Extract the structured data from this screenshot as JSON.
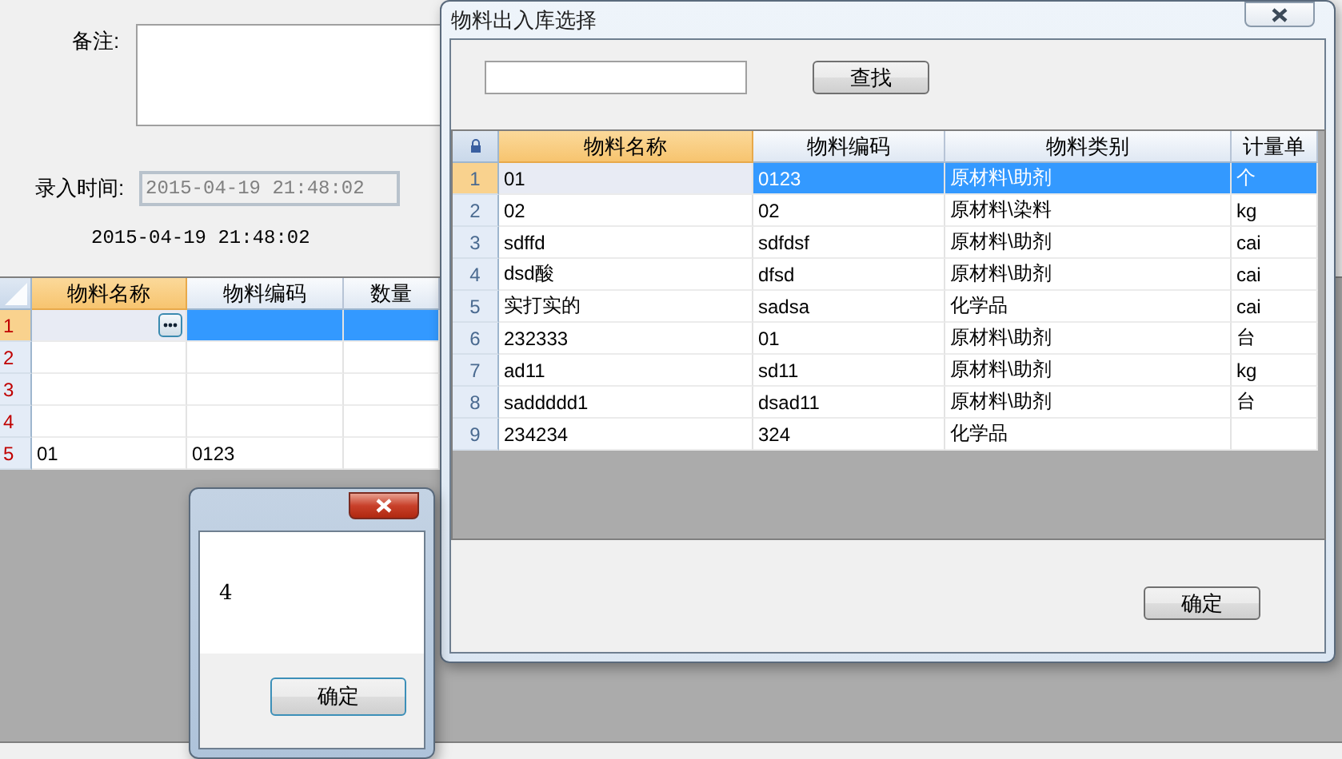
{
  "form": {
    "remark_label": "备注:",
    "entry_time_label": "录入时间:",
    "entry_time_value": "2015-04-19 21:48:02",
    "timestamp_text": "2015-04-19 21:48:02",
    "grid": {
      "columns": [
        {
          "label": "物料名称",
          "selected": true
        },
        {
          "label": "物料编码",
          "selected": false
        },
        {
          "label": "数量",
          "selected": false
        }
      ],
      "rows": [
        {
          "number": "1",
          "selected": true
        },
        {
          "number": "2",
          "selected": false
        },
        {
          "number": "3",
          "selected": false
        },
        {
          "number": "4",
          "selected": false
        },
        {
          "number": "5",
          "selected": false,
          "cells": [
            "01",
            "0123"
          ]
        }
      ]
    }
  },
  "material_dialog": {
    "title": "物料出入库选择",
    "search_button": "查找",
    "grid": {
      "columns": [
        {
          "label": "物料名称",
          "selected": true
        },
        {
          "label": "物料编码",
          "selected": false
        },
        {
          "label": "物料类别",
          "selected": false
        },
        {
          "label": "计量单",
          "selected": false
        }
      ],
      "rows": [
        {
          "number": "1",
          "selected": true,
          "cells": [
            "01",
            "0123",
            "原材料\\助剂",
            "个"
          ]
        },
        {
          "number": "2",
          "selected": false,
          "cells": [
            "02",
            "02",
            "原材料\\染料",
            "kg"
          ]
        },
        {
          "number": "3",
          "selected": false,
          "cells": [
            "sdffd",
            "sdfdsf",
            "原材料\\助剂",
            "cai"
          ]
        },
        {
          "number": "4",
          "selected": false,
          "cells": [
            "dsd酸",
            "dfsd",
            "原材料\\助剂",
            "cai"
          ]
        },
        {
          "number": "5",
          "selected": false,
          "cells": [
            "实打实的",
            "sadsa",
            "化学品",
            "cai"
          ]
        },
        {
          "number": "6",
          "selected": false,
          "cells": [
            "232333",
            "01",
            "原材料\\助剂",
            "台"
          ]
        },
        {
          "number": "7",
          "selected": false,
          "cells": [
            "ad11",
            "sd11",
            "原材料\\助剂",
            "kg"
          ]
        },
        {
          "number": "8",
          "selected": false,
          "cells": [
            "saddddd1",
            "dsad11",
            "原材料\\助剂",
            "台"
          ]
        },
        {
          "number": "9",
          "selected": false,
          "cells": [
            "234234",
            "324",
            "化学品"
          ]
        }
      ]
    },
    "ok_button": "确定"
  },
  "message_box": {
    "message": "4",
    "ok_button": "确定"
  }
}
